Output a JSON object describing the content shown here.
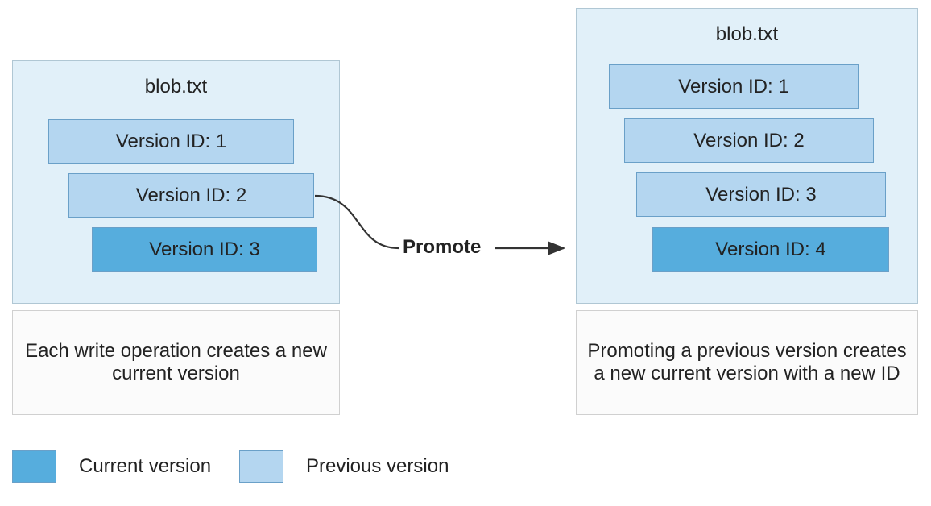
{
  "left": {
    "title": "blob.txt",
    "versions": [
      {
        "label": "Version ID: 1",
        "kind": "previous"
      },
      {
        "label": "Version ID: 2",
        "kind": "previous"
      },
      {
        "label": "Version ID: 3",
        "kind": "current"
      }
    ],
    "caption": "Each write operation creates a new current version"
  },
  "right": {
    "title": "blob.txt",
    "versions": [
      {
        "label": "Version ID: 1",
        "kind": "previous"
      },
      {
        "label": "Version ID: 2",
        "kind": "previous"
      },
      {
        "label": "Version ID: 3",
        "kind": "previous"
      },
      {
        "label": "Version ID: 4",
        "kind": "current"
      }
    ],
    "caption": "Promoting a previous version creates a new current version with a new ID"
  },
  "connector_label": "Promote",
  "legend": {
    "current": "Current version",
    "previous": "Previous version"
  },
  "colors": {
    "container_bg": "#e1f0f9",
    "previous_bg": "#b4d6f0",
    "current_bg": "#56addd",
    "stroke": "#333333"
  },
  "chart_data": {
    "type": "diagram",
    "title": "Blob version promotion",
    "series": [
      {
        "name": "blob.txt (before)",
        "values": [
          "Version ID: 1 (previous)",
          "Version ID: 2 (previous)",
          "Version ID: 3 (current)"
        ]
      },
      {
        "name": "blob.txt (after promote)",
        "values": [
          "Version ID: 1 (previous)",
          "Version ID: 2 (previous)",
          "Version ID: 3 (previous)",
          "Version ID: 4 (current)"
        ]
      }
    ]
  }
}
